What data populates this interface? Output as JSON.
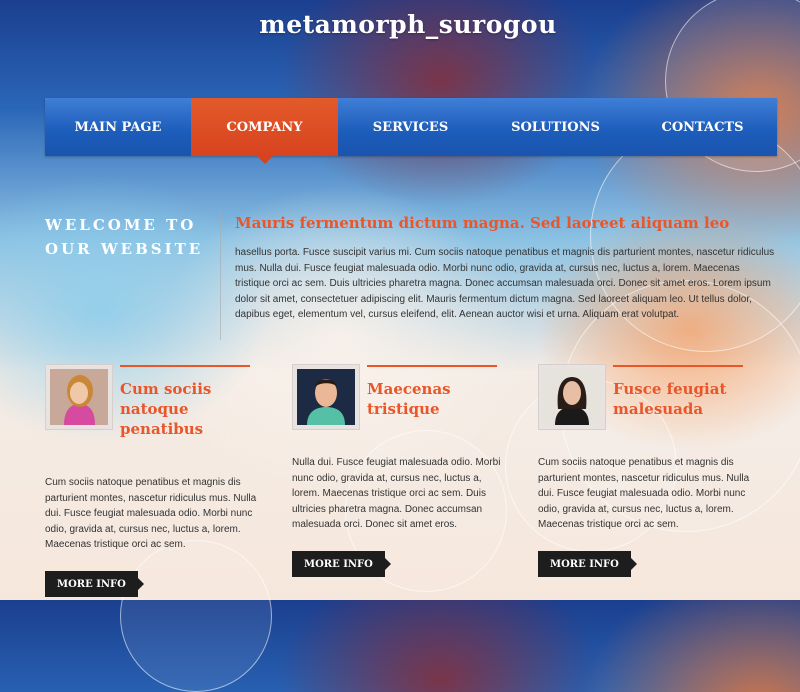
{
  "site": {
    "title": "metamorph_surogou"
  },
  "nav": {
    "items": [
      {
        "label": "MAIN PAGE",
        "active": false
      },
      {
        "label": "COMPANY",
        "active": true
      },
      {
        "label": "SERVICES",
        "active": false
      },
      {
        "label": "SOLUTIONS",
        "active": false
      },
      {
        "label": "CONTACTS",
        "active": false
      }
    ]
  },
  "welcome": {
    "line1": "WELCOME TO",
    "line2": "OUR WEBSITE"
  },
  "intro": {
    "heading": "Mauris fermentum dictum magna. Sed laoreet aliquam leo",
    "body": "hasellus porta. Fusce suscipit varius mi. Cum sociis natoque penatibus et magnis dis parturient montes, nascetur ridiculus mus. Nulla dui. Fusce feugiat malesuada odio. Morbi nunc odio, gravida at, cursus nec, luctus a, lorem. Maecenas tristique orci ac sem. Duis ultricies pharetra magna. Donec accumsan malesuada orci. Donec sit amet eros. Lorem ipsum dolor sit amet, consectetuer adipiscing elit. Mauris fermentum dictum magna. Sed laoreet aliquam leo. Ut tellus dolor, dapibus eget, elementum vel, cursus eleifend, elit. Aenean auctor wisi et urna. Aliquam erat volutpat."
  },
  "columns": [
    {
      "heading": "Cum sociis natoque penatibus",
      "body": "Cum sociis natoque penatibus et magnis dis parturient montes, nascetur ridiculus mus. Nulla dui. Fusce feugiat malesuada odio. Morbi nunc odio, gravida at, cursus nec, luctus a, lorem. Maecenas tristique orci ac sem.",
      "button": "MORE INFO"
    },
    {
      "heading": "Maecenas tristique",
      "body": "Nulla dui. Fusce feugiat malesuada odio. Morbi nunc odio, gravida at, cursus nec, luctus a, lorem. Maecenas tristique orci ac sem. Duis ultricies pharetra magna. Donec accumsan malesuada orci. Donec sit amet eros.",
      "button": "MORE INFO"
    },
    {
      "heading": "Fusce feugiat malesuada",
      "body": "Cum sociis natoque penatibus et magnis dis parturient montes, nascetur ridiculus mus. Nulla dui. Fusce feugiat malesuada odio. Morbi nunc odio, gravida at, cursus nec, luctus a, lorem. Maecenas tristique orci ac sem.",
      "button": "MORE INFO"
    }
  ],
  "colors": {
    "accent": "#e8562a",
    "nav_blue": "#1c5cba",
    "button_dark": "#1d1d1d"
  }
}
